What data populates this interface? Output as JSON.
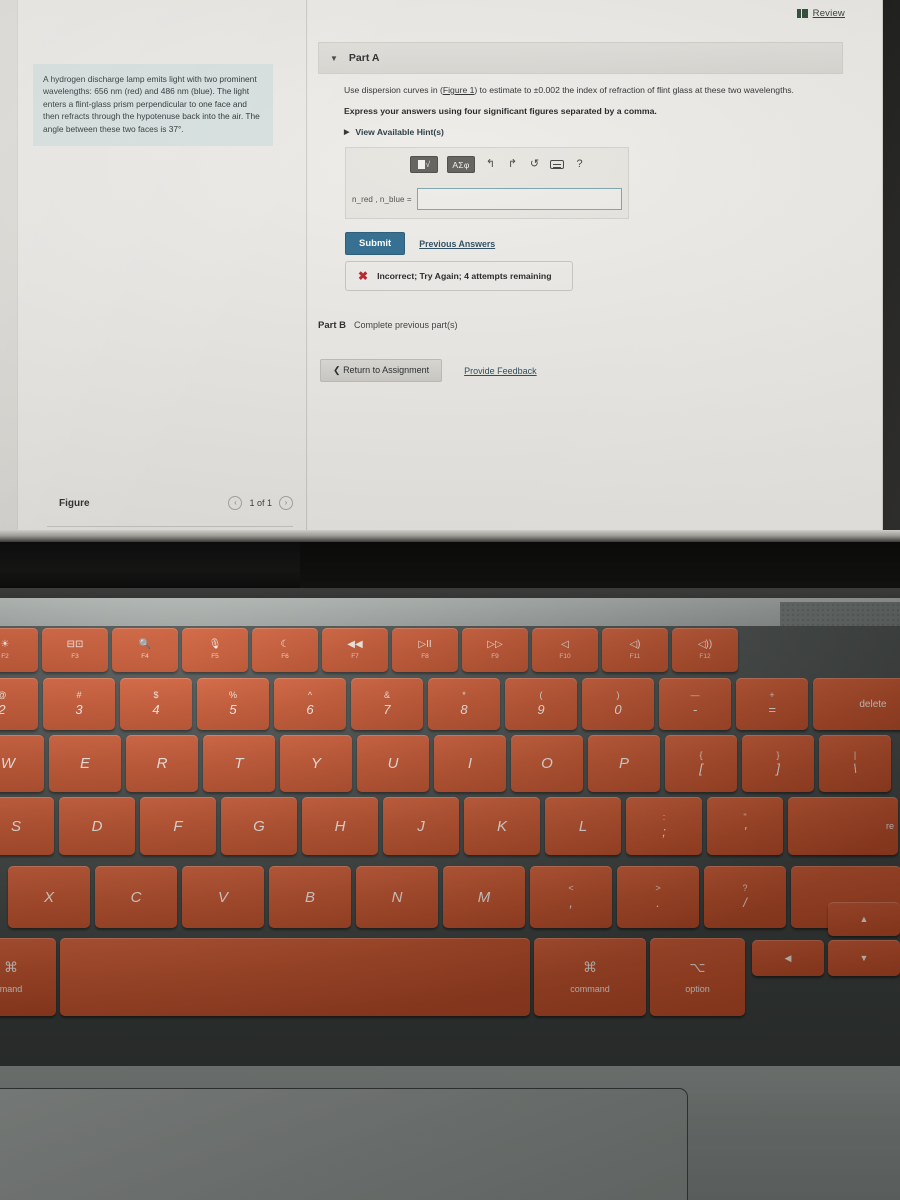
{
  "screen": {
    "review": {
      "label": "Review",
      "icon": "book-icon"
    },
    "problem": {
      "text": "A hydrogen discharge lamp emits light with two prominent wavelengths: 656 nm (red) and 486 nm (blue). The light enters a flint-glass prism perpendicular to one face and then refracts through the hypotenuse back into the air. The angle between these two faces is 37°."
    },
    "figure_panel": {
      "title": "Figure",
      "prev_arrow": "‹",
      "page_count": "1 of 1",
      "next_arrow": "›"
    },
    "part_a": {
      "caret": "▼",
      "title": "Part A",
      "prompt_before_link": "Use dispersion curves in (",
      "figure_link": "Figure 1",
      "prompt_after_link": ") to estimate to ±0.002 the index of refraction of flint glass at these two wavelengths.",
      "instruction": "Express your answers using four significant figures separated by a comma.",
      "hint_triangle": "▶",
      "hint_label": "View Available Hint(s)",
      "toolbar": {
        "template_button": "√",
        "greek_button": "ΑΣφ",
        "undo_icon": "↰",
        "redo_icon": "↱",
        "reset_icon": "↺",
        "keyboard_icon": "keyboard-icon",
        "help_icon": "?"
      },
      "answer_label": "n_red , n_blue =",
      "answer_value": "",
      "answer_placeholder": "",
      "submit_label": "Submit",
      "previous_answers_label": "Previous Answers",
      "feedback": {
        "icon": "✖",
        "message": "Incorrect; Try Again; 4 attempts remaining"
      }
    },
    "part_b": {
      "title": "Part B",
      "status": "Complete previous part(s)"
    },
    "bottom": {
      "return_icon": "❮",
      "return_label": "Return to Assignment",
      "feedback_label": "Provide Feedback"
    }
  },
  "keyboard": {
    "function_row": [
      {
        "icon": "☀",
        "label": "F2"
      },
      {
        "icon": "⊟⊡",
        "label": "F3"
      },
      {
        "icon": "🔍",
        "label": "F4"
      },
      {
        "icon": "🎙",
        "label": "F5"
      },
      {
        "icon": "☾",
        "label": "F6"
      },
      {
        "icon": "◀◀",
        "label": "F7"
      },
      {
        "icon": "▷II",
        "label": "F8"
      },
      {
        "icon": "▷▷",
        "label": "F9"
      },
      {
        "icon": "◁",
        "label": "F10"
      },
      {
        "icon": "◁)",
        "label": "F11"
      },
      {
        "icon": "◁))",
        "label": "F12"
      }
    ],
    "number_row": [
      {
        "top": "@",
        "bottom": "2"
      },
      {
        "top": "#",
        "bottom": "3"
      },
      {
        "top": "$",
        "bottom": "4"
      },
      {
        "top": "%",
        "bottom": "5"
      },
      {
        "top": "^",
        "bottom": "6"
      },
      {
        "top": "&",
        "bottom": "7"
      },
      {
        "top": "*",
        "bottom": "8"
      },
      {
        "top": "(",
        "bottom": "9"
      },
      {
        "top": ")",
        "bottom": "0"
      },
      {
        "top": "—",
        "bottom": "-"
      },
      {
        "top": "+",
        "bottom": "="
      }
    ],
    "delete_label": "delete",
    "row_q": [
      "W",
      "E",
      "R",
      "T",
      "Y",
      "U",
      "I",
      "O",
      "P"
    ],
    "row_q_symbols": [
      {
        "top": "{",
        "bottom": "["
      },
      {
        "top": "}",
        "bottom": "]"
      },
      {
        "top": "|",
        "bottom": "\\"
      }
    ],
    "row_a": [
      "S",
      "D",
      "F",
      "G",
      "H",
      "J",
      "K",
      "L"
    ],
    "row_a_symbols": [
      {
        "top": ":",
        "bottom": ";"
      },
      {
        "top": "\"",
        "bottom": "'"
      }
    ],
    "return_label": "re",
    "row_z": [
      "X",
      "C",
      "V",
      "B",
      "N",
      "M"
    ],
    "row_z_symbols": [
      {
        "top": "<",
        "bottom": ","
      },
      {
        "top": ">",
        "bottom": "."
      },
      {
        "top": "?",
        "bottom": "/"
      }
    ],
    "modifier_row": {
      "command_left_symbol": "⌘",
      "command_left_label": "mand",
      "space_label": "",
      "command_right_symbol": "⌘",
      "command_right_label": "command",
      "option_symbol": "⌥",
      "option_label": "option",
      "arrow_up": "▲",
      "arrow_left": "◀",
      "arrow_down": "▼"
    }
  },
  "colors": {
    "key_orange": "#c6552f",
    "submit_blue": "#2f6b8f",
    "error_red": "#b8232b",
    "problem_box": "#d7e1e0",
    "input_border": "#7da3ad"
  }
}
